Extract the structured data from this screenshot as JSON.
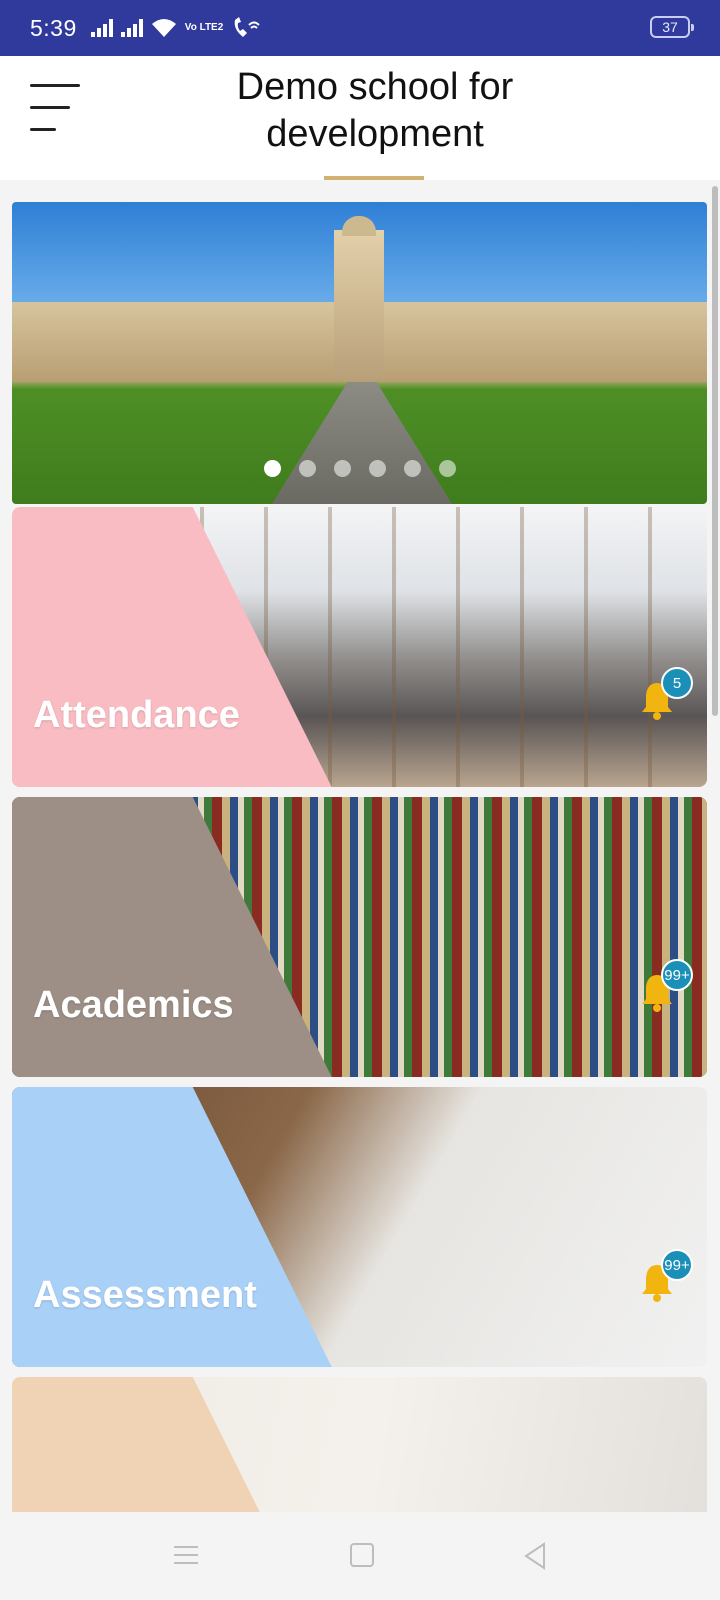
{
  "status_bar": {
    "time": "5:39",
    "volte": "Vo LTE2",
    "battery": "37",
    "icons": [
      "signal-icon",
      "signal-icon",
      "wifi-icon",
      "volte-icon",
      "wifi-calling-icon",
      "battery-icon"
    ]
  },
  "header": {
    "title": "Demo school for development",
    "menu_icon": "hamburger-menu-icon",
    "accent_color": "#d2b274"
  },
  "banner": {
    "slide_count": 6,
    "active_slide": 1
  },
  "modules": [
    {
      "label": "Attendance",
      "badge": "5",
      "icon": "bell-icon",
      "overlay_color": "#f9bcc3"
    },
    {
      "label": "Academics",
      "badge": "99+",
      "icon": "bell-icon",
      "overlay_color": "#9d8f86"
    },
    {
      "label": "Assessment",
      "badge": "99+",
      "icon": "bell-icon",
      "overlay_color": "#a9d0f7"
    },
    {
      "label": "",
      "overlay_color": "#f0d2b4"
    }
  ],
  "colors": {
    "status_bar": "#2f3a9c",
    "badge": "#1a8fb8",
    "bell": "#f2b40f"
  },
  "nav_bar": {
    "icons": [
      "recent-apps-icon",
      "home-icon",
      "back-icon"
    ]
  }
}
